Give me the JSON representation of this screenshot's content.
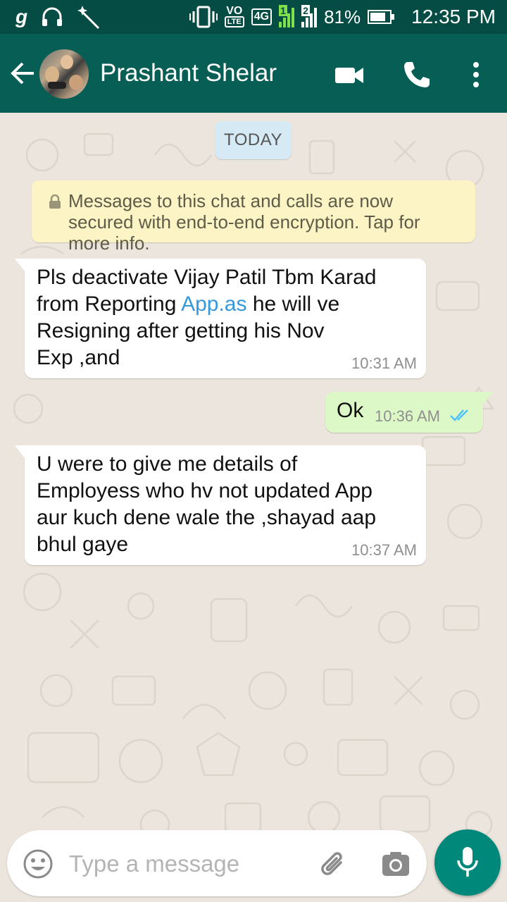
{
  "status_bar": {
    "carrier_glyph": "g",
    "volte_label": "VO",
    "lte_label": "LTE",
    "network_label": "4G",
    "sim1_label": "1",
    "sim2_label": "2",
    "battery_percent": "81%",
    "battery_level": 0.81,
    "time": "12:35 PM",
    "icons": [
      "g-icon",
      "headset-icon",
      "magic-wand-icon",
      "vibrate-icon",
      "signal-icon",
      "battery-icon"
    ]
  },
  "header": {
    "contact_name": "Prashant Shelar",
    "icons": [
      "back-arrow-icon",
      "avatar",
      "video-call-icon",
      "phone-icon",
      "more-options-icon"
    ]
  },
  "chat": {
    "date_label": "TODAY",
    "encryption_notice": "Messages to this chat and calls are now secured with end-to-end encryption. Tap for more info.",
    "messages": [
      {
        "direction": "incoming",
        "lines": [
          "Pls deactivate Vijay Patil Tbm Karad",
          "from Reporting ",
          "App.as",
          " he will ve",
          "Resigning after getting his Nov",
          "Exp ,and"
        ],
        "time": "10:31 AM"
      },
      {
        "direction": "outgoing",
        "text": "Ok",
        "time": "10:36 AM",
        "status": "read"
      },
      {
        "direction": "incoming",
        "lines": [
          "U were to give me details of",
          "Employess who hv not updated App",
          "aur kuch dene wale the ,shayad aap",
          "bhul gaye"
        ],
        "time": "10:37 AM"
      }
    ]
  },
  "composer": {
    "placeholder": "Type a message",
    "icons": [
      "emoji-icon",
      "attachment-icon",
      "camera-icon",
      "mic-icon"
    ]
  },
  "colors": {
    "status_bar": "#054d44",
    "app_bar": "#075e54",
    "chat_background": "#ece5dd",
    "outgoing_bubble": "#dcf8c6",
    "date_chip": "#d5eaf4",
    "notice": "#fcf4c4",
    "link": "#3498db",
    "read_ticks": "#4fc3f7",
    "fab": "#00897b"
  }
}
